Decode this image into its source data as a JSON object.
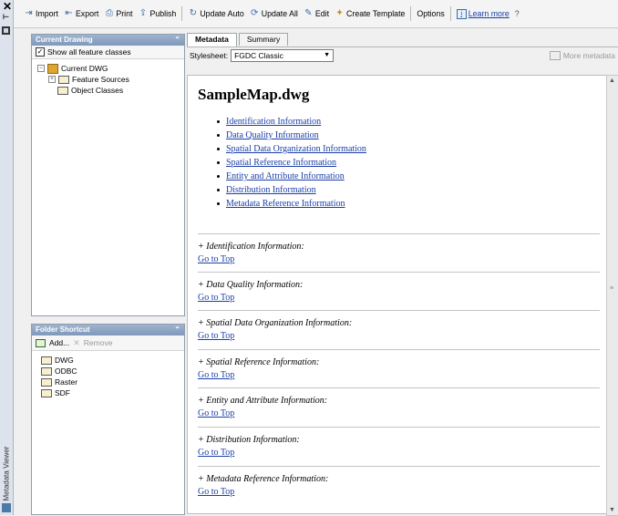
{
  "rail": {
    "title": "Metadata Viewer"
  },
  "toolbar": {
    "import": "Import",
    "export": "Export",
    "print": "Print",
    "publish": "Publish",
    "update_auto": "Update Auto",
    "update_all": "Update All",
    "edit": "Edit",
    "create_template": "Create Template",
    "options": "Options",
    "learn_more": "Learn more",
    "help": "?"
  },
  "current_drawing": {
    "header": "Current Drawing",
    "show_all": "Show all feature classes",
    "tree": {
      "root": "Current DWG",
      "children": [
        "Feature Sources",
        "Object Classes"
      ]
    }
  },
  "folder_shortcut": {
    "header": "Folder Shortcut",
    "add": "Add...",
    "remove": "Remove",
    "items": [
      "DWG",
      "ODBC",
      "Raster",
      "SDF"
    ]
  },
  "tabs": {
    "metadata": "Metadata",
    "summary": "Summary"
  },
  "stylesheet": {
    "label": "Stylesheet:",
    "value": "FGDC Classic",
    "more": "More metadata"
  },
  "doc": {
    "title": "SampleMap.dwg",
    "toc": [
      "Identification Information",
      "Data Quality Information",
      "Spatial Data Organization Information",
      "Spatial Reference Information",
      "Entity and Attribute Information",
      "Distribution Information",
      "Metadata Reference Information"
    ],
    "sections": [
      "+ Identification Information:",
      "+ Data Quality Information:",
      "+ Spatial Data Organization Information:",
      "+ Spatial Reference Information:",
      "+ Entity and Attribute Information:",
      "+ Distribution Information:",
      "+ Metadata Reference Information:"
    ],
    "goto": "Go to Top"
  },
  "colors": {
    "link": "#1a3ea8",
    "panel_header": "#8ba3c6"
  }
}
